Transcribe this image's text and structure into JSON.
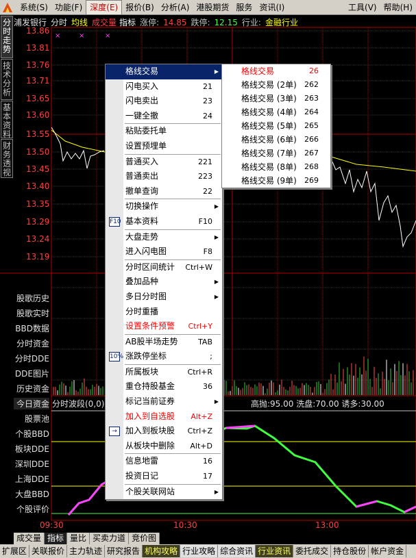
{
  "menubar": {
    "items": [
      "系统(S)",
      "功能(F)",
      "深度(E)",
      "报价(B)",
      "分析(A)",
      "港股期货",
      "服务",
      "资讯(I)",
      "工具(V)",
      "帮助(H)"
    ]
  },
  "sidetabs": [
    "分时走势",
    "技术分析",
    "基本资料",
    "财务透视"
  ],
  "infobar": {
    "stock": "浦发银行",
    "mode": "分时",
    "avg_label": "均线",
    "vol_label": "成交量",
    "indicator": "指标",
    "limit_up_label": "涨停:",
    "limit_up": "14.85",
    "limit_down_label": "跌停:",
    "limit_down": "12.15",
    "industry_label": "行业:",
    "industry": "金融行业"
  },
  "price_ticks": [
    "13.86",
    "13.81",
    "13.76",
    "13.71",
    "13.65",
    "13.60",
    "13.55",
    "13.50",
    "13.45",
    "13.40",
    "13.35",
    "13.29",
    "13.24",
    "13.19"
  ],
  "left_labels": [
    "股歌历史",
    "股歌实时",
    "BBD数据",
    "分时资金",
    "分时DDE",
    "DDE图片",
    "历史资金",
    "今日资金",
    "股票池",
    "个股BBD",
    "板块DDE",
    "深圳DDE",
    "上海DDE",
    "大盘BBD",
    "个股评价"
  ],
  "subinfo": {
    "title": "分时波段(0,0)",
    "metrics": "高抛:95.00  洗盘:70.00  诱多:30.00"
  },
  "time_ticks": [
    "09:30",
    "10:30",
    "13:00"
  ],
  "bottom_tabs": [
    "成交量",
    "指标",
    "量比",
    "买卖力道",
    "竞价图"
  ],
  "footer_tabs": [
    "扩展区",
    "关联报价",
    "主力轨迹",
    "研究报告",
    "机构攻略",
    "行业攻略",
    "综合资讯",
    "行业资讯",
    "委托成交",
    "持仓股份",
    "帐户资金"
  ],
  "context_menu": [
    {
      "label": "格线交易",
      "arrow": true,
      "selected": true
    },
    {
      "label": "闪电买入",
      "shortcut": "21"
    },
    {
      "label": "闪电卖出",
      "shortcut": "23"
    },
    {
      "label": "一键全撤",
      "shortcut": "24"
    },
    {
      "sep": true
    },
    {
      "label": "粘贴委托单"
    },
    {
      "label": "设置预埋单"
    },
    {
      "sep": true
    },
    {
      "label": "普通买入",
      "shortcut": "221"
    },
    {
      "label": "普通卖出",
      "shortcut": "223"
    },
    {
      "label": "撤单查询",
      "shortcut": "22"
    },
    {
      "sep": true
    },
    {
      "label": "切换操作",
      "arrow": true
    },
    {
      "label": "基本资料",
      "shortcut": "F10",
      "icon": "F10"
    },
    {
      "sep": true
    },
    {
      "label": "大盘走势",
      "arrow": true
    },
    {
      "label": "进入闪电图",
      "shortcut": "F8"
    },
    {
      "sep": true
    },
    {
      "label": "分时区间统计",
      "shortcut": "Ctrl+W"
    },
    {
      "label": "叠加品种",
      "arrow": true
    },
    {
      "label": "多日分时图",
      "arrow": true
    },
    {
      "label": "分时重播"
    },
    {
      "label": "设置条件预警",
      "shortcut": "Ctrl+Y",
      "red": true
    },
    {
      "sep": true
    },
    {
      "label": "AB股半场走势",
      "shortcut": "TAB"
    },
    {
      "label": "涨跌停坐标",
      "shortcut": ";",
      "icon": "10%"
    },
    {
      "sep": true
    },
    {
      "label": "所属板块",
      "shortcut": "Ctrl+R"
    },
    {
      "label": "重仓持股基金",
      "shortcut": "36"
    },
    {
      "label": "标记当前证券",
      "arrow": true
    },
    {
      "label": "加入到自选股",
      "shortcut": "Alt+Z",
      "red": true
    },
    {
      "label": "加入到板块股",
      "shortcut": "Ctrl+Z",
      "icon": "→"
    },
    {
      "label": "从板块中删除",
      "shortcut": "Alt+D"
    },
    {
      "sep": true
    },
    {
      "label": "信息地雷",
      "shortcut": "16"
    },
    {
      "label": "投资日记",
      "shortcut": "17"
    },
    {
      "sep": true
    },
    {
      "label": "个股关联网站",
      "arrow": true
    }
  ],
  "submenu": [
    {
      "label": "格线交易",
      "shortcut": "26",
      "red": true
    },
    {
      "label": "格线交易 (2单)",
      "shortcut": "262"
    },
    {
      "label": "格线交易 (3单)",
      "shortcut": "263"
    },
    {
      "label": "格线交易 (4单)",
      "shortcut": "264"
    },
    {
      "label": "格线交易 (5单)",
      "shortcut": "265"
    },
    {
      "label": "格线交易 (6单)",
      "shortcut": "266"
    },
    {
      "label": "格线交易 (7单)",
      "shortcut": "267"
    },
    {
      "label": "格线交易 (8单)",
      "shortcut": "268"
    },
    {
      "label": "格线交易 (9单)",
      "shortcut": "269"
    }
  ],
  "colors": {
    "price_line": "#ffffff",
    "avg_line": "#ffff00",
    "grid": "#b00000",
    "vol_up": "#ff5050",
    "vol_down": "#30d030",
    "wave_up": "#ff40ff",
    "wave_down": "#40ff40"
  }
}
